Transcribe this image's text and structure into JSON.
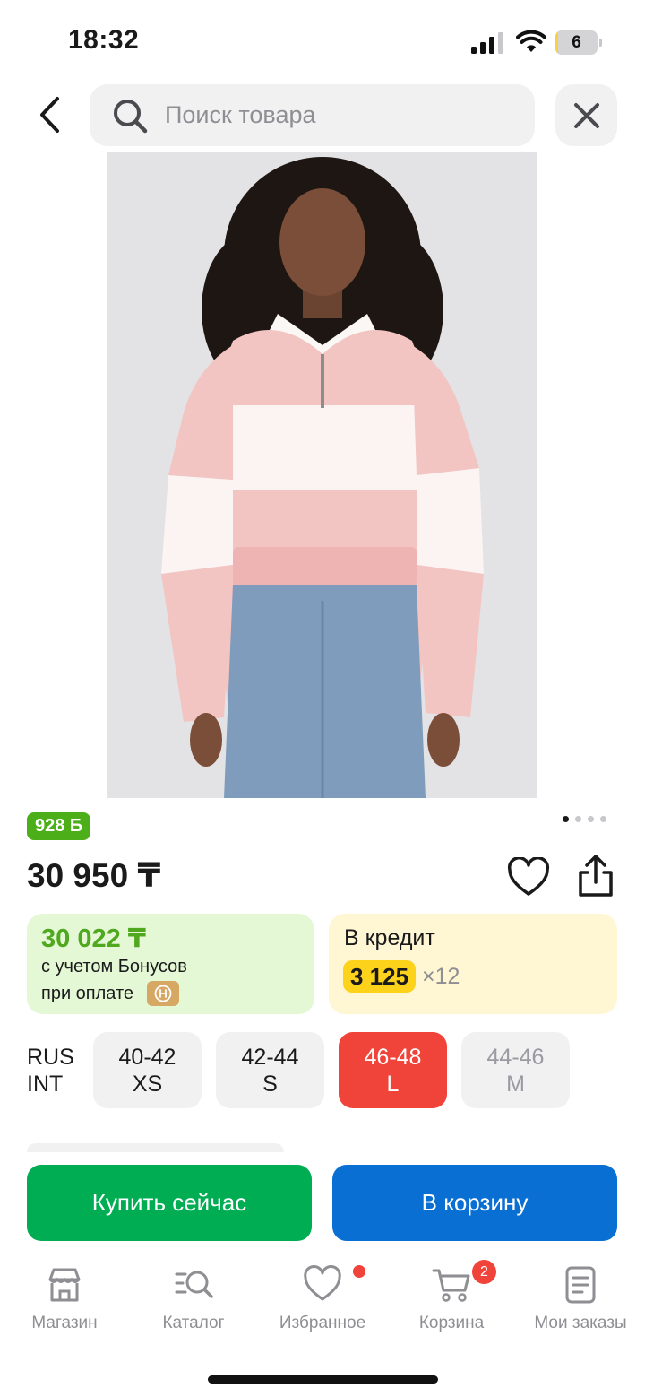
{
  "status_bar": {
    "time": "18:32",
    "battery": "6",
    "battery_level": 0.06,
    "icons": [
      "signal-icon",
      "wifi-icon",
      "battery-icon"
    ]
  },
  "header": {
    "search_placeholder": "Поиск товара",
    "icons": {
      "back": "chevron-left-icon",
      "search": "search-icon",
      "close": "close-icon"
    }
  },
  "gallery": {
    "total_images": 4,
    "active_index": 0
  },
  "product": {
    "bonus_badge": "928 Б",
    "price": "30 950 ₸",
    "actions": {
      "favorite": "heart-icon",
      "share": "share-icon"
    }
  },
  "bonus_offer": {
    "price": "30 022 ₸",
    "line1": "с учетом Бонусов",
    "line2": "при оплате"
  },
  "credit_offer": {
    "title": "В кредит",
    "monthly": "3 125",
    "months": "×12"
  },
  "sizes": {
    "label_line1": "RUS",
    "label_line2": "INT",
    "options": [
      {
        "rus": "40-42",
        "int": "XS",
        "state": "available"
      },
      {
        "rus": "42-44",
        "int": "S",
        "state": "available"
      },
      {
        "rus": "46-48",
        "int": "L",
        "state": "selected"
      },
      {
        "rus": "44-46",
        "int": "M",
        "state": "unavailable"
      }
    ]
  },
  "buttons": {
    "buy_now": "Купить сейчас",
    "add_to_cart": "В корзину"
  },
  "colors": {
    "green": "#00ad53",
    "blue": "#0a6fd2",
    "red": "#f0433a",
    "bonus_green": "#4fa81e",
    "credit_yellow": "#fcd21a"
  },
  "tab_bar": {
    "items": [
      {
        "label": "Магазин",
        "icon": "store-icon"
      },
      {
        "label": "Каталог",
        "icon": "catalog-search-icon"
      },
      {
        "label": "Избранное",
        "icon": "heart-icon"
      },
      {
        "label": "Корзина",
        "icon": "cart-icon"
      },
      {
        "label": "Мои заказы",
        "icon": "orders-icon"
      }
    ],
    "cart_count": "2"
  }
}
